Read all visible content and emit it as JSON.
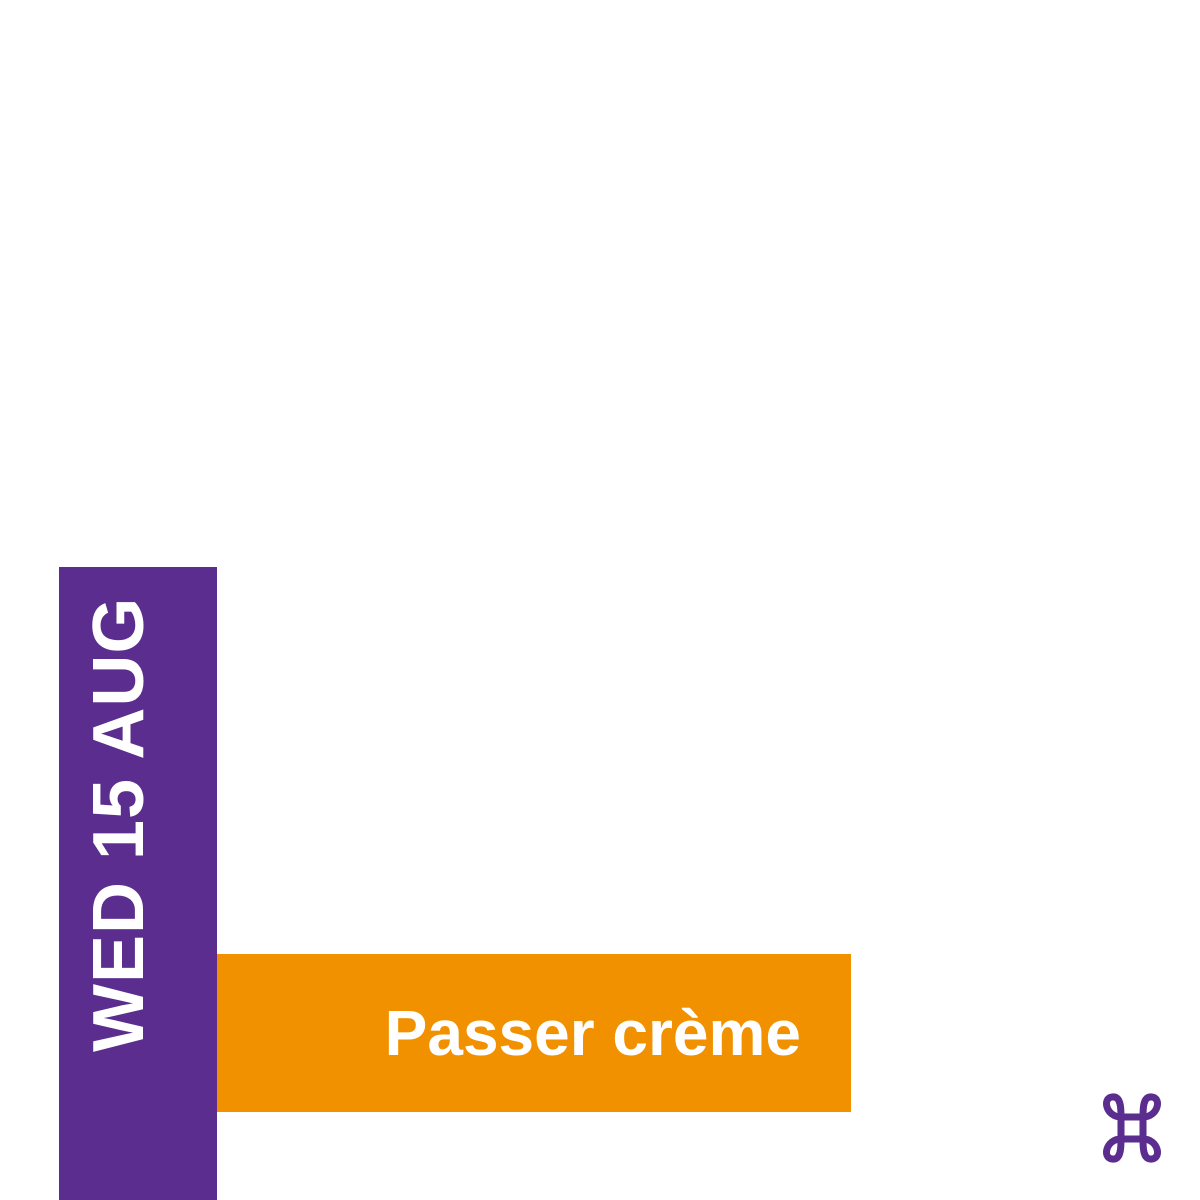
{
  "event": {
    "date_label": "WED 15 AUG",
    "title": "Passer crème"
  },
  "brand": {
    "logo_icon": "command-key-icon"
  },
  "colors": {
    "background": "#ffffff",
    "date_bar": "#5b2d8e",
    "title_bar": "#f29100",
    "text": "#ffffff",
    "logo": "#5b2d8e"
  }
}
